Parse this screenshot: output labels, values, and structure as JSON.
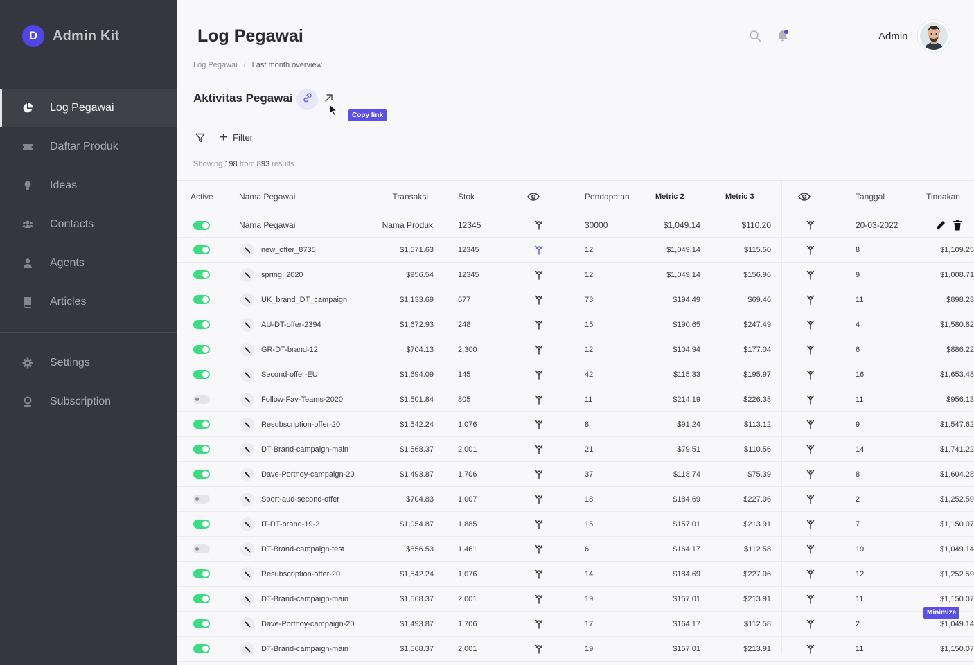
{
  "brand": {
    "logo_letter": "D",
    "name": "Admin Kit"
  },
  "sidebar": {
    "items": [
      {
        "label": "Log Pegawai",
        "icon": "pie-chart-icon",
        "active": true
      },
      {
        "label": "Daftar Produk",
        "icon": "ticket-icon"
      },
      {
        "label": "Ideas",
        "icon": "lightbulb-icon"
      },
      {
        "label": "Contacts",
        "icon": "users-icon"
      },
      {
        "label": "Agents",
        "icon": "agent-icon"
      },
      {
        "label": "Articles",
        "icon": "book-icon"
      },
      {
        "label": "Settings",
        "icon": "gear-icon"
      },
      {
        "label": "Subscription",
        "icon": "subscription-icon"
      }
    ]
  },
  "header": {
    "title": "Log Pegawai",
    "user": "Admin"
  },
  "breadcrumb": {
    "items": [
      "Log Pegawai",
      "Last month overview"
    ]
  },
  "section": {
    "title": "Aktivitas Pegawai",
    "tooltip": "Copy link"
  },
  "filter": {
    "label": "Filter"
  },
  "showing": {
    "prefix": "Showing",
    "shown": "198",
    "mid": "from",
    "total": "893",
    "suffix": "results"
  },
  "table": {
    "columns": {
      "active": "Active",
      "name": "Nama Pegawai",
      "transaksi": "Transaksi",
      "stok": "Stok",
      "pendapatan": "Pendapatan",
      "metric2": "Metric 2",
      "metric3": "Metric 3",
      "tanggal": "Tanggal",
      "tindakan": "Tindakan"
    },
    "first_row": {
      "name": "Nama Pegawai",
      "transaksi": "Nama Produk",
      "stok": "12345",
      "pendapatan": "30000",
      "metric2": "$1,049.14",
      "metric3": "$110.20",
      "tanggal": "20-03-2022"
    },
    "rows": [
      {
        "active": true,
        "name": "new_offer_8735",
        "transaksi": "$1,571.63",
        "stok": "12345",
        "pendapatan": "12",
        "metric2": "$1,049.14",
        "metric3": "$115.50",
        "tanggal": "8",
        "tindakan": "$1,109.25"
      },
      {
        "active": true,
        "name": "spring_2020",
        "transaksi": "$956.54",
        "stok": "12345",
        "pendapatan": "12",
        "metric2": "$1,049.14",
        "metric3": "$156.96",
        "tanggal": "9",
        "tindakan": "$1,008.71"
      },
      {
        "active": true,
        "name": "UK_brand_DT_campaign",
        "transaksi": "$1,133.69",
        "stok": "677",
        "pendapatan": "73",
        "metric2": "$194.49",
        "metric3": "$69.46",
        "tanggal": "11",
        "tindakan": "$898.23"
      },
      {
        "active": true,
        "name": "AU-DT-offer-2394",
        "transaksi": "$1,672.93",
        "stok": "248",
        "pendapatan": "15",
        "metric2": "$190.65",
        "metric3": "$247.49",
        "tanggal": "4",
        "tindakan": "$1,580.82"
      },
      {
        "active": true,
        "name": "GR-DT-brand-12",
        "transaksi": "$704.13",
        "stok": "2,300",
        "pendapatan": "12",
        "metric2": "$104.94",
        "metric3": "$177.04",
        "tanggal": "6",
        "tindakan": "$886.22"
      },
      {
        "active": true,
        "name": "Second-offer-EU",
        "transaksi": "$1,694.09",
        "stok": "145",
        "pendapatan": "42",
        "metric2": "$115.33",
        "metric3": "$195.97",
        "tanggal": "16",
        "tindakan": "$1,653.48"
      },
      {
        "active": false,
        "name": "Follow-Fav-Teams-2020",
        "transaksi": "$1,501.84",
        "stok": "805",
        "pendapatan": "11",
        "metric2": "$214.19",
        "metric3": "$226.38",
        "tanggal": "11",
        "tindakan": "$956.13"
      },
      {
        "active": true,
        "name": "Resubscription-offer-20",
        "transaksi": "$1,542.24",
        "stok": "1,076",
        "pendapatan": "8",
        "metric2": "$91.24",
        "metric3": "$113.12",
        "tanggal": "9",
        "tindakan": "$1,547.62"
      },
      {
        "active": true,
        "name": "DT-Brand-campaign-main",
        "transaksi": "$1,568.37",
        "stok": "2,001",
        "pendapatan": "21",
        "metric2": "$79.51",
        "metric3": "$110.56",
        "tanggal": "14",
        "tindakan": "$1,741.22"
      },
      {
        "active": true,
        "name": "Dave-Portnoy-campaign-20",
        "transaksi": "$1,493.87",
        "stok": "1,706",
        "pendapatan": "37",
        "metric2": "$118.74",
        "metric3": "$75.39",
        "tanggal": "8",
        "tindakan": "$1,604.28"
      },
      {
        "active": false,
        "name": "Sport-aud-second-offer",
        "transaksi": "$704.83",
        "stok": "1,007",
        "pendapatan": "18",
        "metric2": "$184.69",
        "metric3": "$227.06",
        "tanggal": "2",
        "tindakan": "$1,252.59"
      },
      {
        "active": true,
        "name": "IT-DT-brand-19-2",
        "transaksi": "$1,054.87",
        "stok": "1,885",
        "pendapatan": "15",
        "metric2": "$157.01",
        "metric3": "$213.91",
        "tanggal": "7",
        "tindakan": "$1,150.07"
      },
      {
        "active": false,
        "name": "DT-Brand-campaign-test",
        "transaksi": "$856.53",
        "stok": "1,461",
        "pendapatan": "6",
        "metric2": "$164.17",
        "metric3": "$112.58",
        "tanggal": "19",
        "tindakan": "$1,049.14"
      },
      {
        "active": true,
        "name": "Resubscription-offer-20",
        "transaksi": "$1,542.24",
        "stok": "1,076",
        "pendapatan": "14",
        "metric2": "$184.69",
        "metric3": "$227.06",
        "tanggal": "12",
        "tindakan": "$1,252.59"
      },
      {
        "active": true,
        "name": "DT-Brand-campaign-main",
        "transaksi": "$1,568.37",
        "stok": "2,001",
        "pendapatan": "19",
        "metric2": "$157.01",
        "metric3": "$213.91",
        "tanggal": "11",
        "tindakan": "$1,150.07"
      },
      {
        "active": true,
        "name": "Dave-Portnoy-campaign-20",
        "transaksi": "$1,493.87",
        "stok": "1,706",
        "pendapatan": "17",
        "metric2": "$164.17",
        "metric3": "$112.58",
        "tanggal": "2",
        "tindakan": "$1,049.14"
      },
      {
        "active": true,
        "name": "DT-Brand-campaign-main",
        "transaksi": "$1,568.37",
        "stok": "2,001",
        "pendapatan": "19",
        "metric2": "$157.01",
        "metric3": "$213.91",
        "tanggal": "11",
        "tindakan": "$1,150.07"
      }
    ]
  },
  "minimize_label": "Minimize",
  "colors": {
    "accent": "#5b4fe6",
    "sidebar": "#363640",
    "toggle_on": "#3ddc84"
  }
}
